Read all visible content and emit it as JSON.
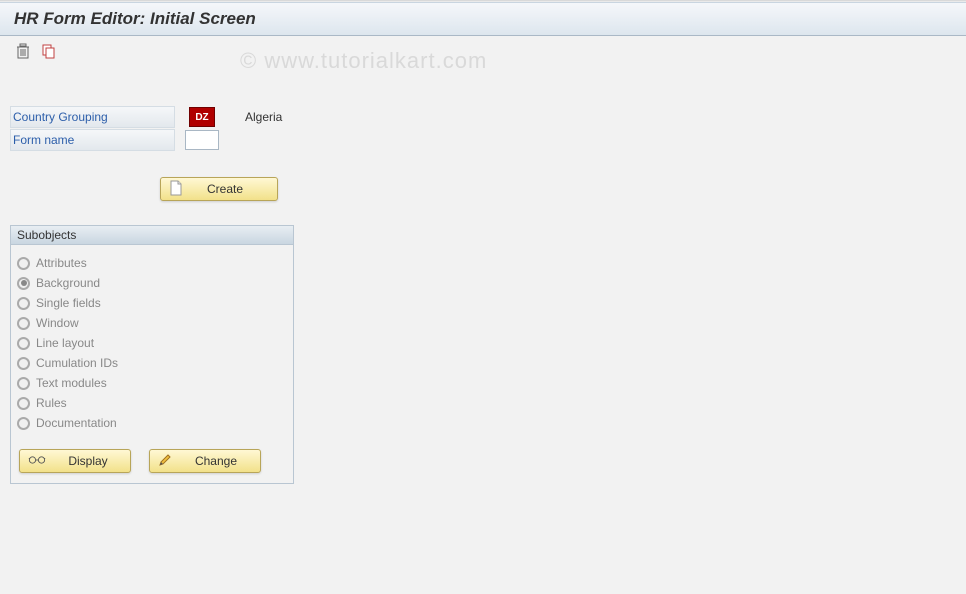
{
  "header": {
    "title": "HR Form Editor: Initial Screen"
  },
  "watermark": "© www.tutorialkart.com",
  "fields": {
    "countryGrouping": {
      "label": "Country Grouping",
      "code": "DZ",
      "text": "Algeria"
    },
    "formName": {
      "label": "Form name",
      "value": ""
    }
  },
  "buttons": {
    "create": "Create",
    "display": "Display",
    "change": "Change"
  },
  "subobjects": {
    "title": "Subobjects",
    "items": [
      {
        "label": "Attributes",
        "selected": false
      },
      {
        "label": "Background",
        "selected": true
      },
      {
        "label": "Single fields",
        "selected": false
      },
      {
        "label": "Window",
        "selected": false
      },
      {
        "label": "Line layout",
        "selected": false
      },
      {
        "label": "Cumulation IDs",
        "selected": false
      },
      {
        "label": "Text modules",
        "selected": false
      },
      {
        "label": "Rules",
        "selected": false
      },
      {
        "label": "Documentation",
        "selected": false
      }
    ]
  }
}
